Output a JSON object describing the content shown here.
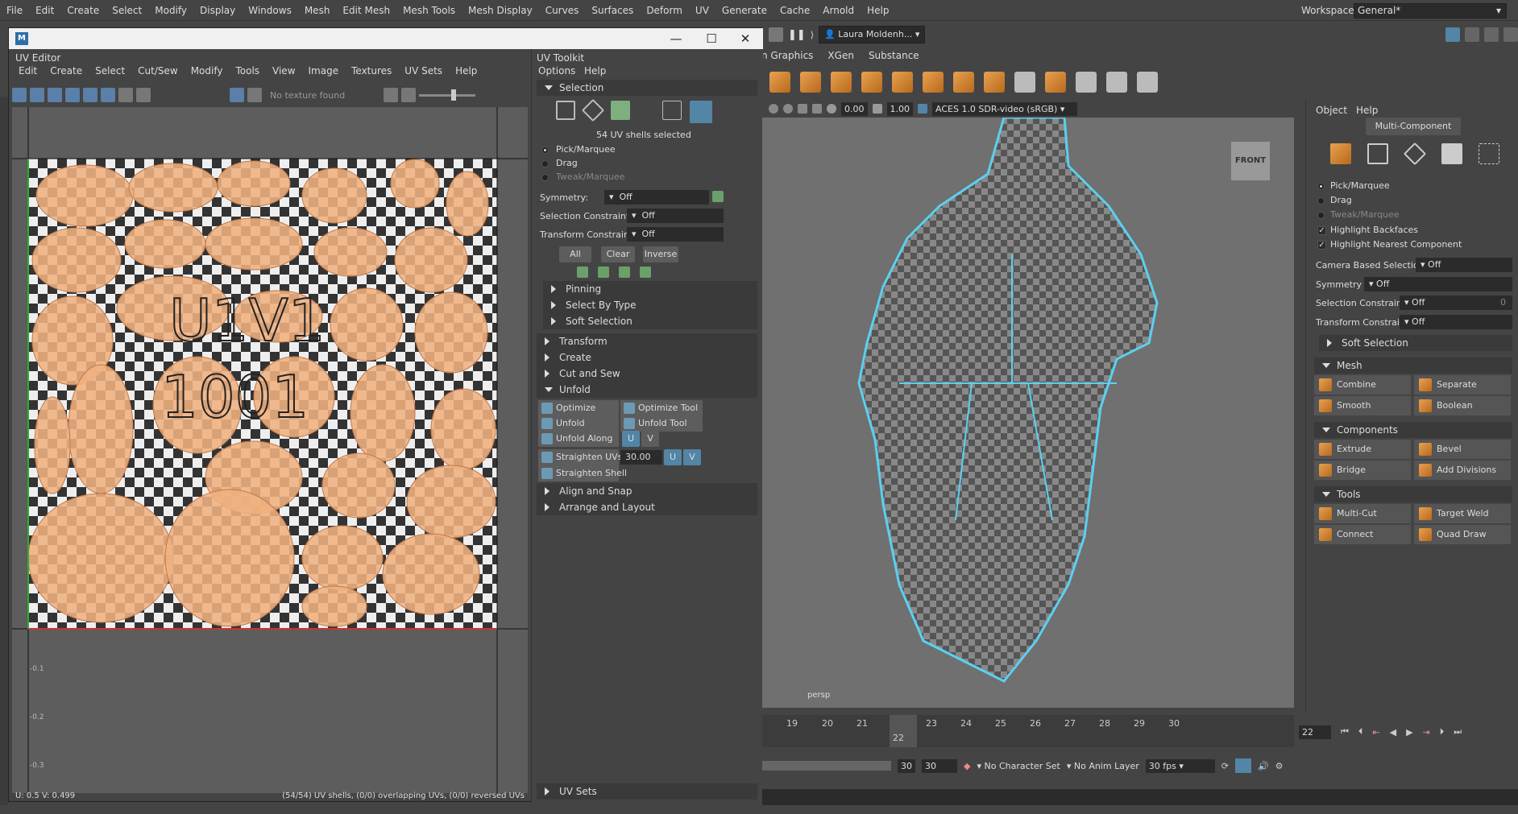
{
  "menubar": {
    "items": [
      "File",
      "Edit",
      "Create",
      "Select",
      "Modify",
      "Display",
      "Windows",
      "Mesh",
      "Edit Mesh",
      "Mesh Tools",
      "Mesh Display",
      "Curves",
      "Surfaces",
      "Deform",
      "UV",
      "Generate",
      "Cache",
      "Arnold",
      "Help"
    ],
    "workspace_label": "Workspace:",
    "workspace_value": "General*"
  },
  "status": {
    "user": "Laura Moldenh..."
  },
  "shelf": {
    "tabs": [
      "n Graphics",
      "XGen",
      "Substance"
    ]
  },
  "uv_window": {
    "panel_title": "UV Editor",
    "menu": [
      "Edit",
      "Create",
      "Select",
      "Cut/Sew",
      "Modify",
      "Tools",
      "View",
      "Image",
      "Textures",
      "UV Sets",
      "Help"
    ],
    "no_texture": "No texture found",
    "tile_label_1": "U1V1",
    "tile_label_2": "1001",
    "axis_labels": [
      "-0.1",
      "-0.2",
      "-0.3"
    ],
    "coord_readout": "U: 0.5  V: 0.499",
    "shell_status": "(54/54) UV shells, (0/0) overlapping UVs, (0/0) reversed UVs"
  },
  "uv_toolkit": {
    "title": "UV Toolkit",
    "menu": [
      "Options",
      "Help"
    ],
    "selection_header": "Selection",
    "selected_count": "54 UV shells selected",
    "modes": [
      "Pick/Marquee",
      "Drag",
      "Tweak/Marquee"
    ],
    "symmetry_label": "Symmetry:",
    "symmetry_value": "Off",
    "selection_constraint_label": "Selection Constraint:",
    "selection_constraint_value": "Off",
    "transform_constraint_label": "Transform Constraint:",
    "transform_constraint_value": "Off",
    "buttons": {
      "all": "All",
      "clear": "Clear",
      "inverse": "Inverse"
    },
    "sub_sections": [
      "Pinning",
      "Select By Type",
      "Soft Selection"
    ],
    "sections": [
      "Transform",
      "Create",
      "Cut and Sew"
    ],
    "unfold_header": "Unfold",
    "unfold": {
      "optimize": "Optimize",
      "optimize_tool": "Optimize Tool",
      "unfold": "Unfold",
      "unfold_tool": "Unfold Tool",
      "unfold_along": "Unfold Along",
      "u": "U",
      "v": "V",
      "straighten_uvs": "Straighten UVs",
      "straighten_value": "30.00",
      "straighten_shell": "Straighten Shell"
    },
    "after_sections": [
      "Align and Snap",
      "Arrange and Layout"
    ],
    "uv_sets": "UV Sets"
  },
  "viewport": {
    "field_1": "0.00",
    "field_2": "1.00",
    "color_space": "ACES 1.0 SDR-video (sRGB)",
    "view_cube": "FRONT",
    "camera": "persp"
  },
  "timeline": {
    "ticks": [
      "19",
      "20",
      "21",
      "22",
      "23",
      "24",
      "25",
      "26",
      "27",
      "28",
      "29",
      "30"
    ],
    "current_frame_label": "22",
    "current_frame": "22",
    "range_end_a": "30",
    "range_end_b": "30",
    "character_set": "No Character Set",
    "anim_layer": "No Anim Layer",
    "fps": "30 fps"
  },
  "modeling_toolkit": {
    "menu": [
      "Object",
      "Help"
    ],
    "multi_component": "Multi-Component",
    "modes": [
      "Pick/Marquee",
      "Drag",
      "Tweak/Marquee"
    ],
    "highlight_backfaces": "Highlight Backfaces",
    "highlight_nearest": "Highlight Nearest Component",
    "camera_based_label": "Camera Based Selection",
    "camera_based_value": "Off",
    "symmetry_label": "Symmetry",
    "symmetry_value": "Off",
    "selection_constraint_label": "Selection Constraint",
    "selection_constraint_value": "Off",
    "selection_constraint_num": "0",
    "transform_constraint_label": "Transform Constraint",
    "transform_constraint_value": "Off",
    "soft_selection": "Soft Selection",
    "mesh_header": "Mesh",
    "mesh": [
      "Combine",
      "Separate",
      "Smooth",
      "Boolean"
    ],
    "components_header": "Components",
    "components": [
      "Extrude",
      "Bevel",
      "Bridge",
      "Add Divisions"
    ],
    "tools_header": "Tools",
    "tools": [
      "Multi-Cut",
      "Target Weld",
      "Connect",
      "Quad Draw"
    ]
  },
  "colors": {
    "accent": "#5285a6",
    "selection": "#5bd0f0",
    "uv_shell": "#f0b07f"
  }
}
